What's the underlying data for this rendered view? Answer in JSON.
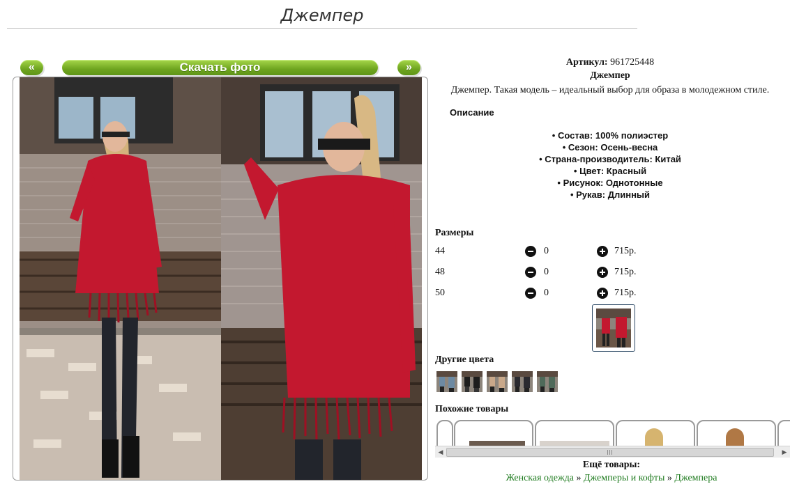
{
  "page": {
    "title": "Джемпер"
  },
  "nav": {
    "prev_label": "«",
    "download_label": "Скачать фото",
    "next_label": "»"
  },
  "product": {
    "sku_label": "Артикул:",
    "sku_value": "961725448",
    "name": "Джемпер",
    "description": "Джемпер. Такая модель – идеальный выбор для образа в молодежном стиле.",
    "description_heading": "Описание",
    "attributes": [
      "Состав: 100% полиэстер",
      "Сезон: Осень-весна",
      "Страна-производитель: Китай",
      "Цвет: Красный",
      "Рисунок: Однотонные",
      "Рукав: Длинный"
    ]
  },
  "sizes": {
    "heading": "Размеры",
    "rows": [
      {
        "size": "44",
        "qty": "0",
        "price": "715р."
      },
      {
        "size": "48",
        "qty": "0",
        "price": "715р."
      },
      {
        "size": "50",
        "qty": "0",
        "price": "715р."
      }
    ]
  },
  "other_colors": {
    "heading": "Другие цвета",
    "count": 5
  },
  "similar": {
    "heading": "Похожие товары"
  },
  "more": {
    "heading": "Ещё товары:",
    "crumbs": [
      "Женская одежда",
      "Джемперы и кофты",
      "Джемпера"
    ],
    "separator": "»"
  },
  "colors": {
    "accent_green": "#6fa51f",
    "product_red": "#c3182f",
    "link_green": "#1d7a1d"
  }
}
